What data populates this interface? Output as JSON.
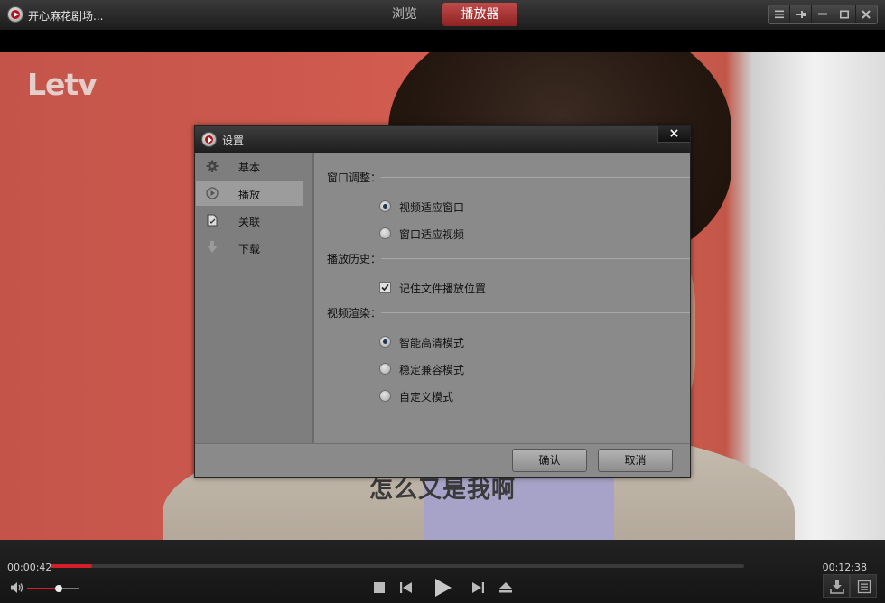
{
  "window": {
    "title": "开心麻花剧场...",
    "tabs": [
      {
        "label": "浏览",
        "active": false
      },
      {
        "label": "播放器",
        "active": true
      }
    ],
    "controls": [
      "menu-icon",
      "pin-icon",
      "minimize-icon",
      "maximize-icon",
      "close-icon"
    ]
  },
  "video": {
    "watermark": "Letv",
    "subtitle": "怎么又是我啊"
  },
  "dialog": {
    "title": "设置",
    "close_label": "×",
    "sidebar": [
      {
        "label": "基本",
        "icon": "gear-icon",
        "active": false
      },
      {
        "label": "播放",
        "icon": "play-circle-icon",
        "active": true
      },
      {
        "label": "关联",
        "icon": "file-associate-icon",
        "active": false
      },
      {
        "label": "下载",
        "icon": "download-arrow-icon",
        "active": false
      }
    ],
    "sections": {
      "window_adjust": {
        "heading": "窗口调整：",
        "options": [
          {
            "label": "视频适应窗口",
            "selected": true
          },
          {
            "label": "窗口适应视频",
            "selected": false
          }
        ]
      },
      "history": {
        "heading": "播放历史：",
        "checkbox": {
          "label": "记住文件播放位置",
          "checked": true
        }
      },
      "render": {
        "heading": "视频渲染：",
        "options": [
          {
            "label": "智能高清模式",
            "selected": true
          },
          {
            "label": "稳定兼容模式",
            "selected": false
          },
          {
            "label": "自定义模式",
            "selected": false
          }
        ]
      }
    },
    "buttons": {
      "ok": "确认",
      "cancel": "取消"
    }
  },
  "player": {
    "current_time": "00:00:42",
    "total_time": "00:12:38",
    "progress_fraction": 0.06,
    "volume_fraction": 0.6,
    "accent_color": "#d21f2a"
  }
}
